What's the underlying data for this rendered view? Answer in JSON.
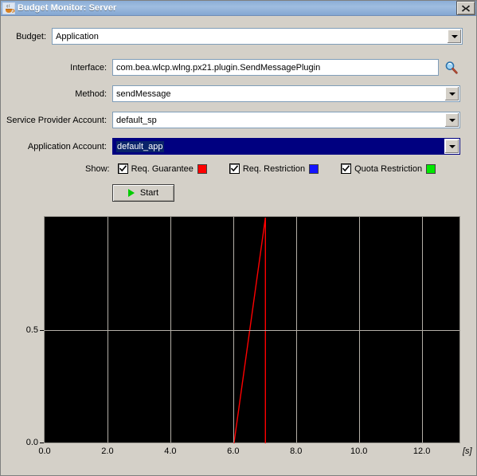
{
  "window": {
    "title": "Budget Monitor: Server",
    "icon": "java-coffee-cup-icon",
    "close_label": "✕"
  },
  "form": {
    "budget": {
      "label": "Budget:",
      "value": "Application",
      "type": "combobox"
    },
    "interface": {
      "label": "Interface:",
      "value": "com.bea.wlcp.wlng.px21.plugin.SendMessagePlugin",
      "type": "textfield",
      "browse_icon": "magnifier-icon"
    },
    "method": {
      "label": "Method:",
      "value": "sendMessage",
      "type": "combobox"
    },
    "service_provider_account": {
      "label": "Service Provider Account:",
      "value": "default_sp",
      "type": "combobox"
    },
    "application_account": {
      "label": "Application Account:",
      "value": "default_app",
      "type": "combobox",
      "selected": true
    }
  },
  "show": {
    "label": "Show:",
    "options": [
      {
        "label": "Req. Guarantee",
        "checked": true,
        "color": "#ff0000"
      },
      {
        "label": "Req. Restriction",
        "checked": true,
        "color": "#1414ff"
      },
      {
        "label": "Quota Restriction",
        "checked": true,
        "color": "#00e800"
      }
    ]
  },
  "actions": {
    "start_label": "Start",
    "start_icon": "play-triangle-icon"
  },
  "chart_data": {
    "type": "line",
    "title": "",
    "xlabel": "[s]",
    "ylabel": "",
    "xlim": [
      0.0,
      13.2
    ],
    "ylim": [
      0.0,
      1.0
    ],
    "x_ticks": [
      "0.0",
      "2.0",
      "4.0",
      "6.0",
      "8.0",
      "10.0",
      "12.0"
    ],
    "x_tick_values": [
      0.0,
      2.0,
      4.0,
      6.0,
      8.0,
      10.0,
      12.0
    ],
    "y_ticks": [
      "0.0",
      "0.5"
    ],
    "y_tick_values": [
      0.0,
      0.5
    ],
    "grid": true,
    "grid_color": "#b4b0a8",
    "background": "#000000",
    "legend_position": "above-plot",
    "series": [
      {
        "name": "Req. Guarantee",
        "color": "#ff0000",
        "points": [
          {
            "x": 6.0,
            "y": 0.0
          },
          {
            "x": 7.0,
            "y": 1.0
          },
          {
            "x": 7.0,
            "y": 0.0
          }
        ]
      },
      {
        "name": "Req. Restriction",
        "color": "#1414ff",
        "points": []
      },
      {
        "name": "Quota Restriction",
        "color": "#00e800",
        "points": []
      }
    ]
  }
}
